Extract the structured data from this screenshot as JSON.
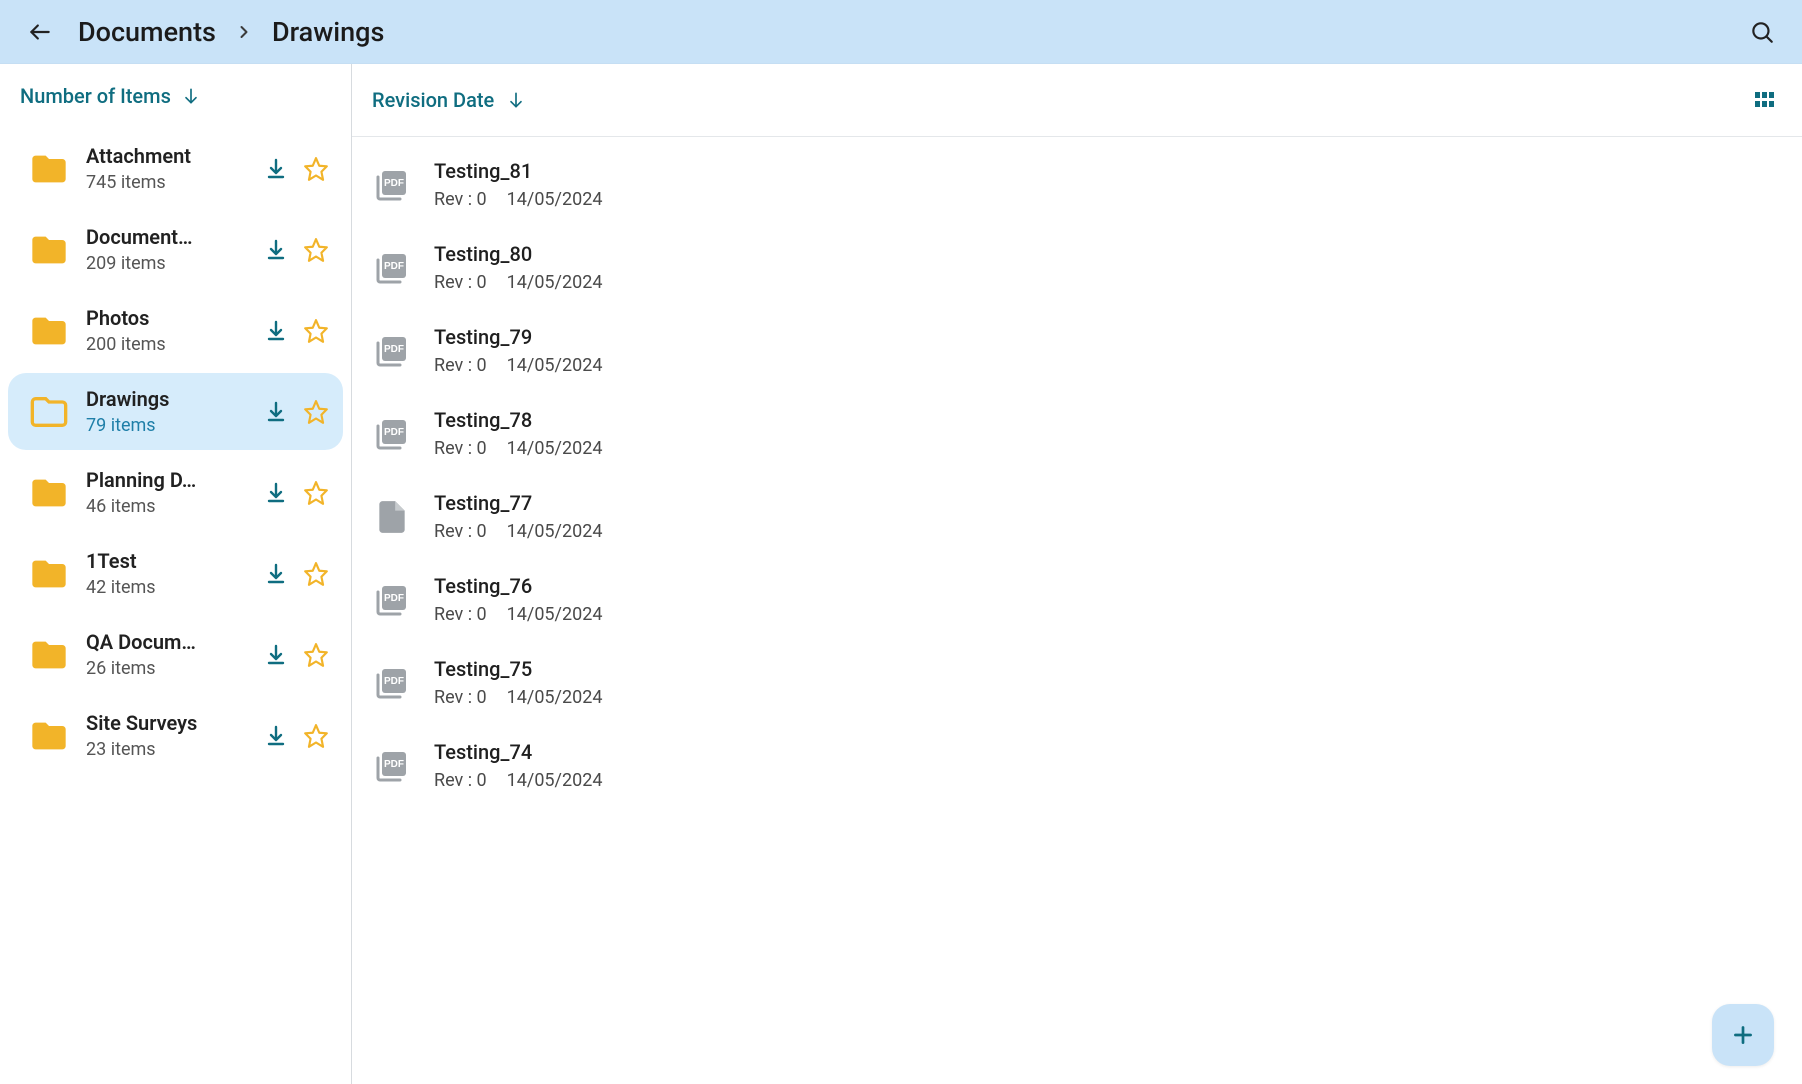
{
  "header": {
    "crumb_root": "Documents",
    "crumb_current": "Drawings"
  },
  "sidebar": {
    "sort_label": "Number of Items",
    "items_word": "items",
    "folders": [
      {
        "name": "Attachment",
        "count": 745,
        "selected": false
      },
      {
        "name": "Document…",
        "count": 209,
        "selected": false
      },
      {
        "name": "Photos",
        "count": 200,
        "selected": false
      },
      {
        "name": "Drawings",
        "count": 79,
        "selected": true
      },
      {
        "name": "Planning D…",
        "count": 46,
        "selected": false
      },
      {
        "name": "1Test",
        "count": 42,
        "selected": false
      },
      {
        "name": "QA Docum…",
        "count": 26,
        "selected": false
      },
      {
        "name": "Site Surveys",
        "count": 23,
        "selected": false
      }
    ]
  },
  "main": {
    "sort_label": "Revision Date",
    "rev_prefix": "Rev : ",
    "files": [
      {
        "name": "Testing_81",
        "rev": 0,
        "date": "14/05/2024",
        "type": "pdf"
      },
      {
        "name": "Testing_80",
        "rev": 0,
        "date": "14/05/2024",
        "type": "pdf"
      },
      {
        "name": "Testing_79",
        "rev": 0,
        "date": "14/05/2024",
        "type": "pdf"
      },
      {
        "name": "Testing_78",
        "rev": 0,
        "date": "14/05/2024",
        "type": "pdf"
      },
      {
        "name": "Testing_77",
        "rev": 0,
        "date": "14/05/2024",
        "type": "file"
      },
      {
        "name": "Testing_76",
        "rev": 0,
        "date": "14/05/2024",
        "type": "pdf"
      },
      {
        "name": "Testing_75",
        "rev": 0,
        "date": "14/05/2024",
        "type": "pdf"
      },
      {
        "name": "Testing_74",
        "rev": 0,
        "date": "14/05/2024",
        "type": "pdf"
      }
    ]
  }
}
